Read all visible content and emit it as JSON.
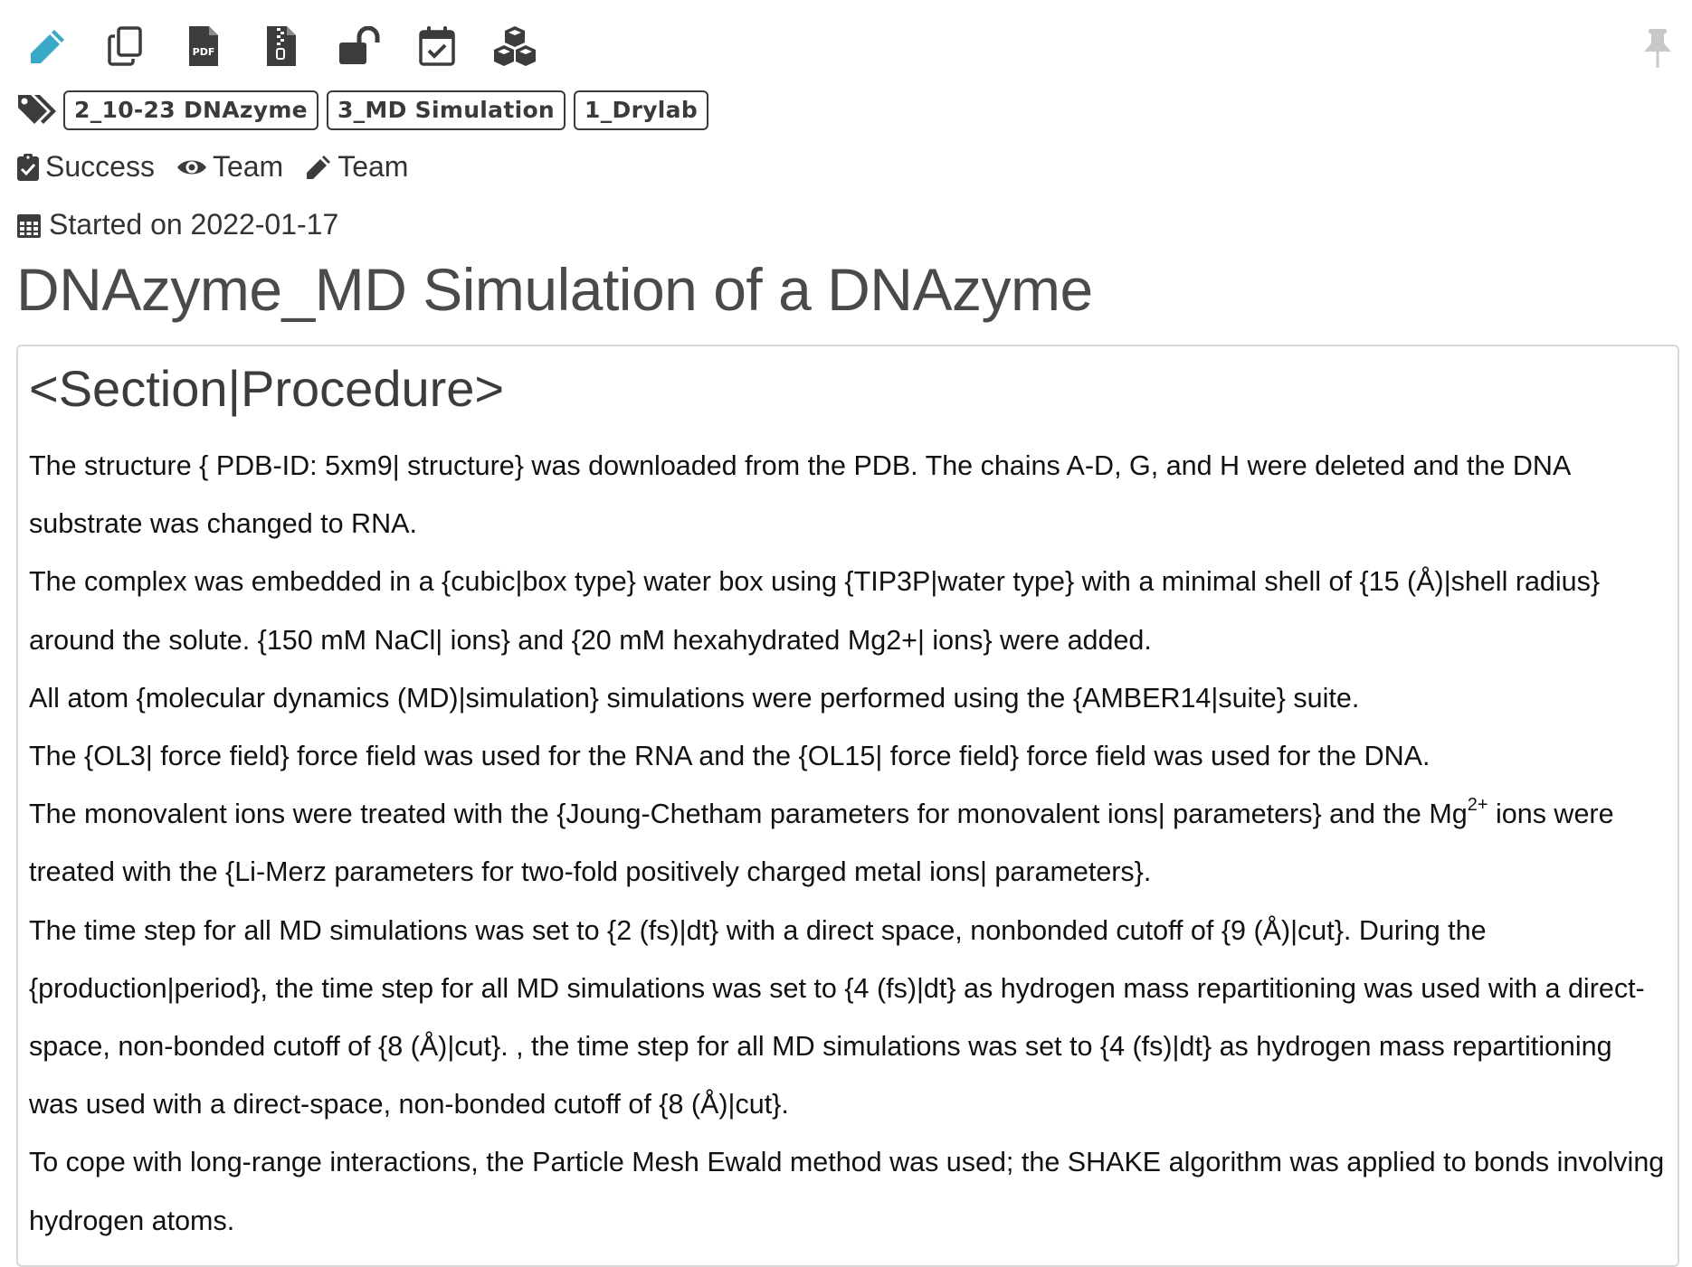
{
  "toolbar": {
    "icons": [
      "pencil-icon",
      "copy-icon",
      "pdf-icon",
      "zip-file-icon",
      "unlock-icon",
      "calendar-check-icon",
      "cubes-icon"
    ],
    "pencil_color": "#3aa9c8",
    "icon_color": "#3c3c3c",
    "pdf_label": "PDF"
  },
  "pin": {
    "icon": "pin-icon",
    "color": "#c8c8c8"
  },
  "tags": [
    "2_10-23 DNAzyme",
    "3_MD Simulation",
    "1_Drylab"
  ],
  "status": {
    "state": "Success",
    "visibility": "Team",
    "write_access": "Team"
  },
  "started": "Started on 2022-01-17",
  "title": "DNAzyme_MD Simulation of a DNAzyme",
  "section": {
    "heading": "<Section|Procedure>",
    "paragraphs": [
      "The structure { PDB-ID: 5xm9| structure} was downloaded from the PDB. The chains A-D, G, and H were deleted and the DNA substrate was changed to RNA.",
      "The complex was embedded in a {cubic|box type} water box using {TIP3P|water type} with a minimal shell of {15 (Å)|shell radius} around the solute. {150 mM NaCl| ions} and {20 mM hexahydrated Mg2+| ions} were added.",
      "All atom {molecular dynamics (MD)|simulation} simulations were performed using the {AMBER14|suite} suite.",
      "The {OL3| force field} force field was used for the RNA and the {OL15| force field} force field was used for the DNA.",
      {
        "before": "The monovalent ions were treated with the {Joung-Chetham parameters for monovalent ions| parameters} and the Mg",
        "sup": "2+",
        "after": " ions were treated with the {Li-Merz parameters for two-fold positively charged metal ions| parameters}."
      },
      "The time step for all MD simulations was set to {2 (fs)|dt} with a direct space, nonbonded cutoff of {9 (Å)|cut}. During the {production|period}, the time step for all MD simulations was set to {4 (fs)|dt} as hydrogen mass repartitioning was used with a direct-space, non-bonded cutoff of {8 (Å)|cut}. , the time step for all MD simulations was set to {4 (fs)|dt} as hydrogen mass repartitioning was used with a direct-space, non-bonded cutoff of {8 (Å)|cut}.",
      "To cope with long-range interactions, the Particle Mesh Ewald method was used; the SHAKE algorithm was applied to bonds involving hydrogen atoms."
    ]
  }
}
